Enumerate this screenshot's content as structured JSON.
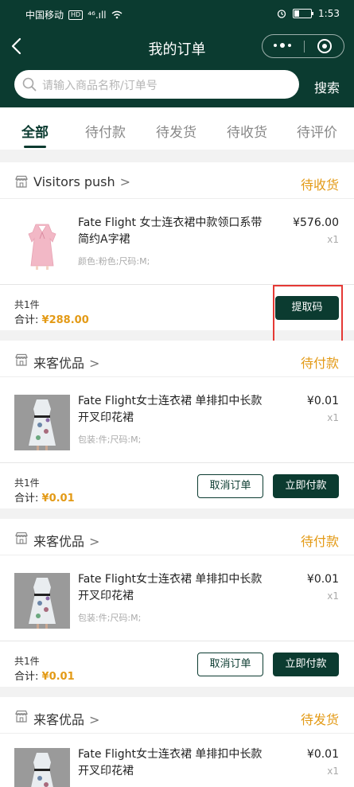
{
  "status_bar": {
    "carrier": "中国移动",
    "hd": "HD",
    "network": "⁴⁶.ıll",
    "time": "1:53"
  },
  "header": {
    "title": "我的订单",
    "search_placeholder": "请输入商品名称/订单号",
    "search_button": "搜索"
  },
  "tabs": [
    {
      "label": "全部",
      "active": true
    },
    {
      "label": "待付款",
      "active": false
    },
    {
      "label": "待发货",
      "active": false
    },
    {
      "label": "待收货",
      "active": false
    },
    {
      "label": "待评价",
      "active": false
    }
  ],
  "colors": {
    "brand": "#0b3b30",
    "accent": "#e39a16",
    "highlight": "#e53935"
  },
  "orders": [
    {
      "shop": "Visitors push",
      "status": "待收货",
      "item_title": "Fate Flight 女士连衣裙中款领口系带简约A字裙",
      "item_spec": "颜色:粉色;尺码:M;",
      "item_price": "¥576.00",
      "item_qty": "x1",
      "count": "共1件",
      "total_label": "合计:",
      "total": "¥288.00",
      "buttons": [
        {
          "label": "提取码",
          "style": "primary"
        }
      ]
    },
    {
      "shop": "来客优品",
      "status": "待付款",
      "item_title": "Fate Flight女士连衣裙 单排扣中长款开叉印花裙",
      "item_spec": "包装:件;尺码:M;",
      "item_price": "¥0.01",
      "item_qty": "x1",
      "count": "共1件",
      "total_label": "合计:",
      "total": "¥0.01",
      "buttons": [
        {
          "label": "取消订单",
          "style": "outline"
        },
        {
          "label": "立即付款",
          "style": "primary"
        }
      ]
    },
    {
      "shop": "来客优品",
      "status": "待付款",
      "item_title": "Fate Flight女士连衣裙 单排扣中长款开叉印花裙",
      "item_spec": "包装:件;尺码:M;",
      "item_price": "¥0.01",
      "item_qty": "x1",
      "count": "共1件",
      "total_label": "合计:",
      "total": "¥0.01",
      "buttons": [
        {
          "label": "取消订单",
          "style": "outline"
        },
        {
          "label": "立即付款",
          "style": "primary"
        }
      ]
    },
    {
      "shop": "来客优品",
      "status": "待发货",
      "item_title": "Fate Flight女士连衣裙 单排扣中长款开叉印花裙",
      "item_price": "¥0.01",
      "item_qty": "x1"
    }
  ]
}
